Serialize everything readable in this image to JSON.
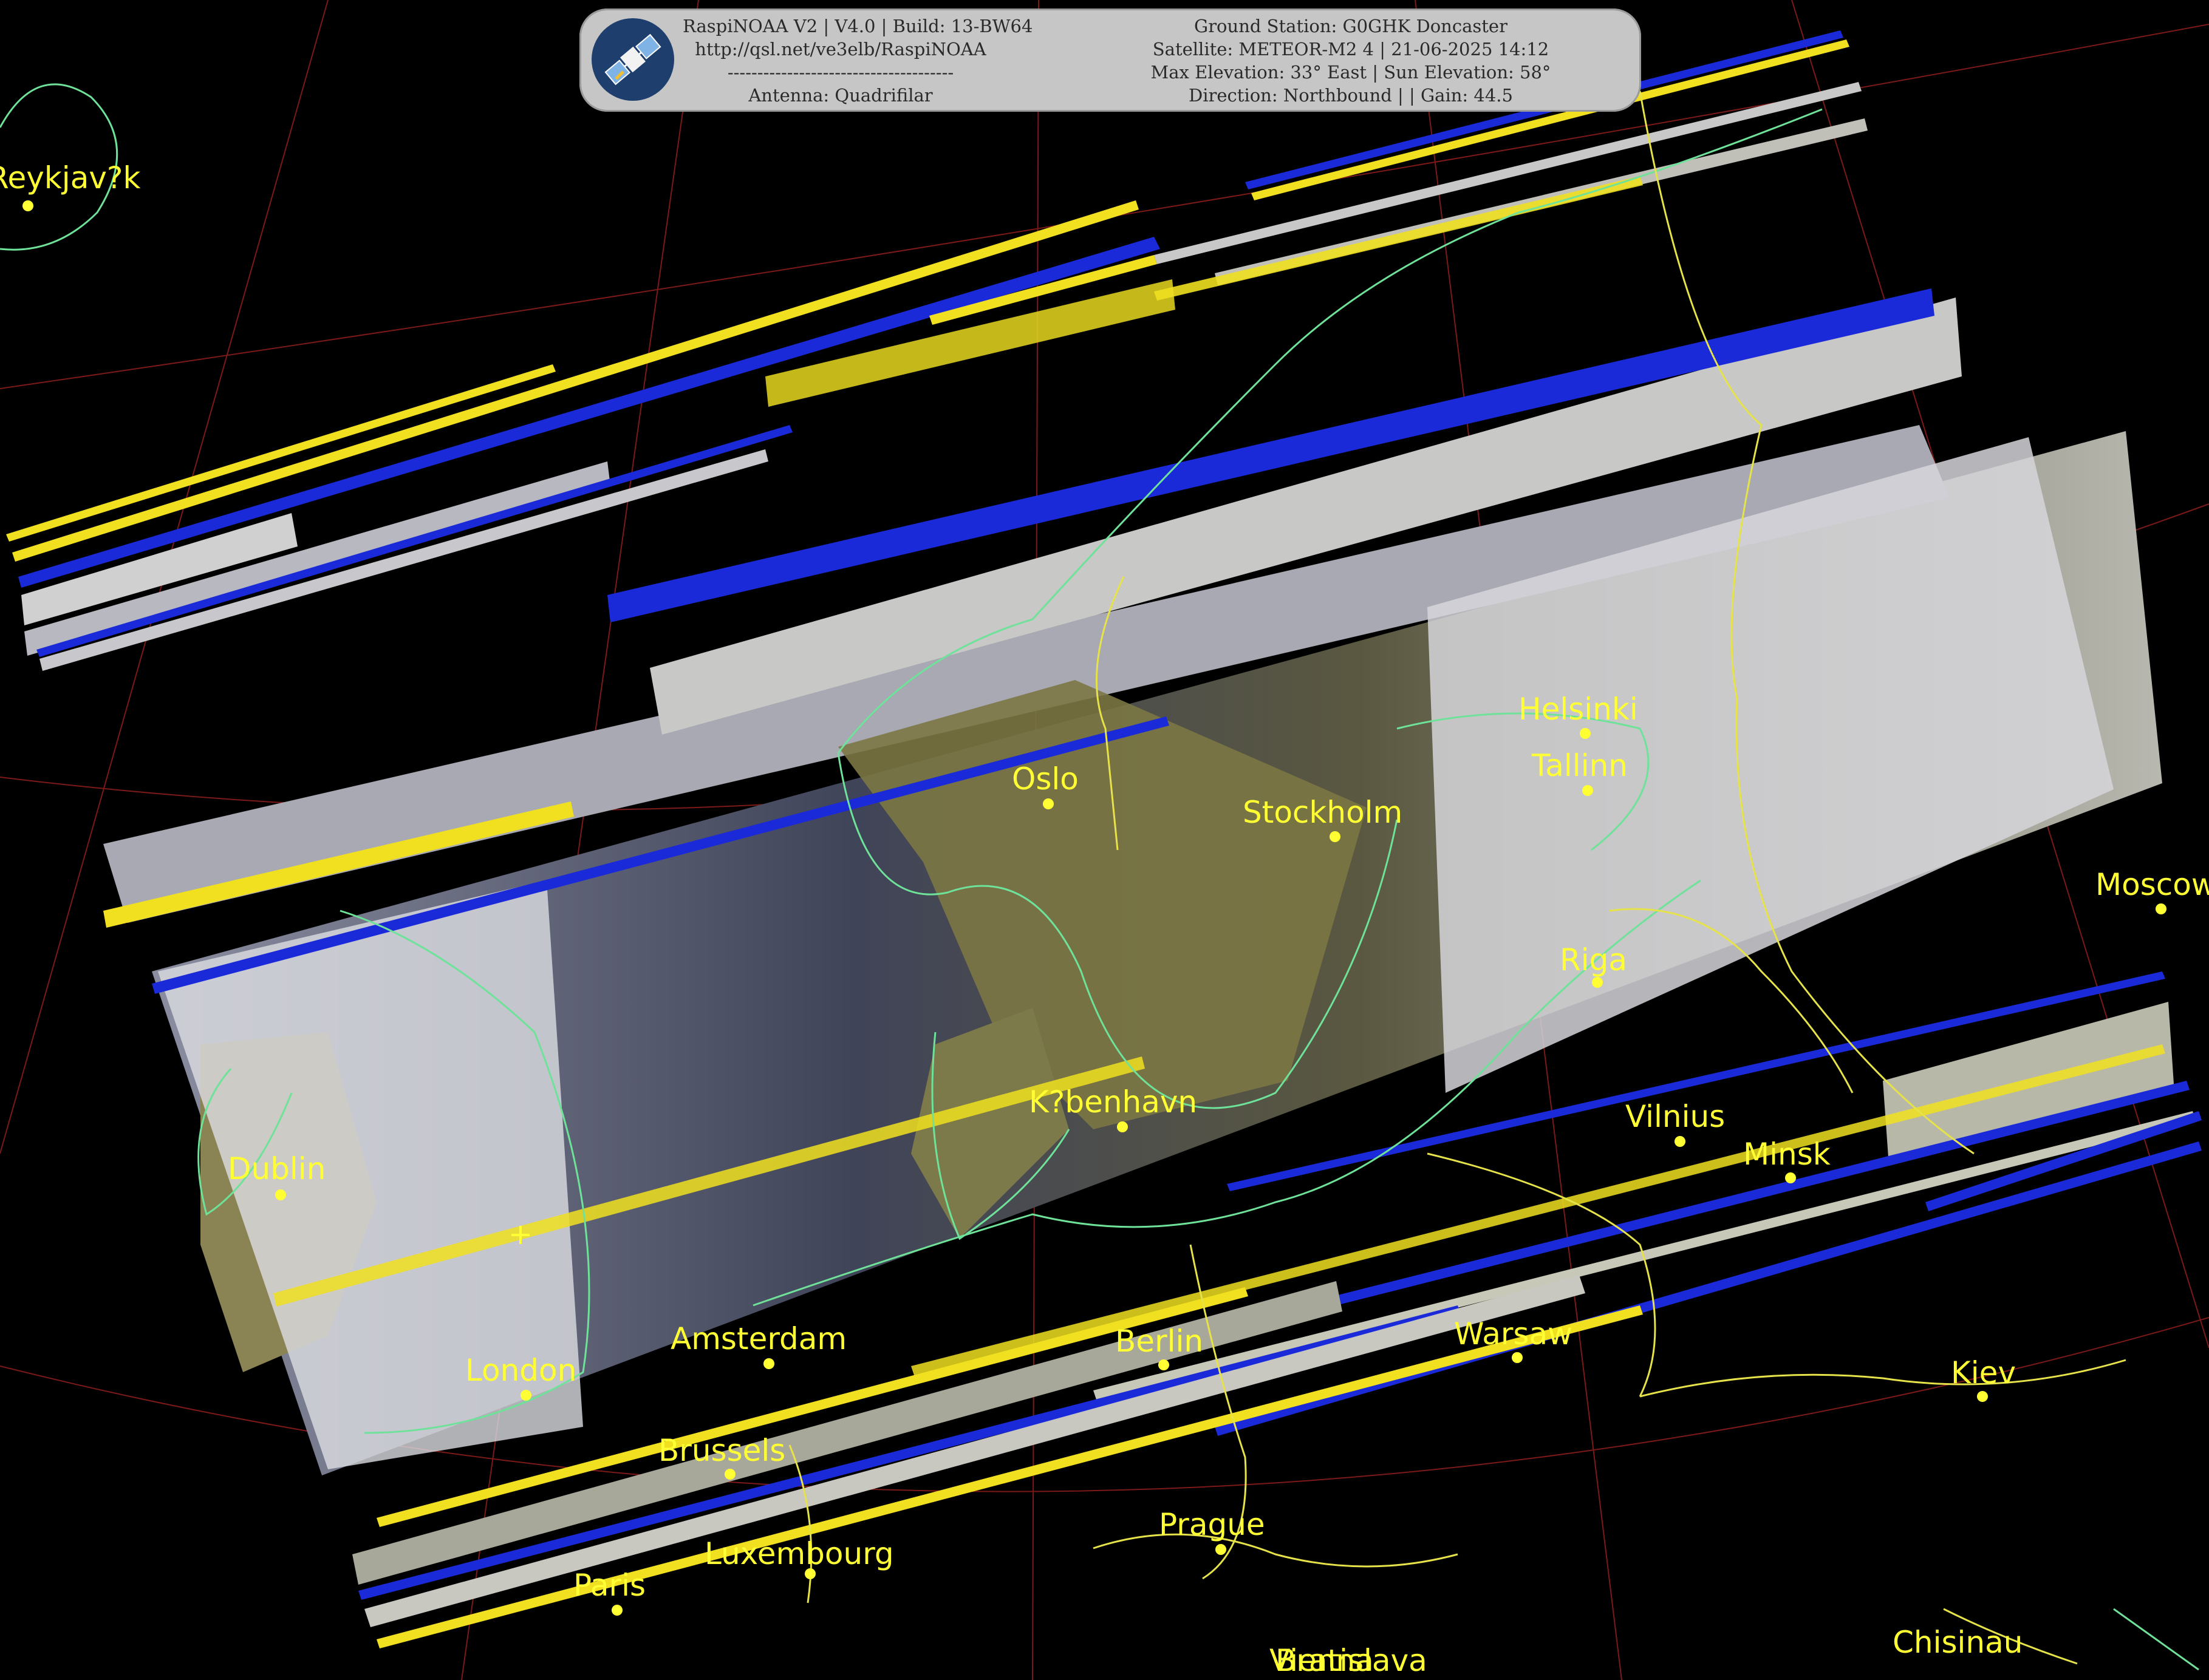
{
  "info": {
    "line1_left": "RaspiNOAA V2 | V4.0 | Build: 13-BW64",
    "line2_left": "http://qsl.net/ve3elb/RaspiNOAA",
    "line3_left": "--------------------------------------",
    "line4_left": "Antenna: Quadrifilar",
    "line1_right": "Ground Station: G0GHK Doncaster",
    "line2_right": "Satellite: METEOR-M2 4 | 21-06-2025 14:12",
    "line3_right": "Max Elevation: 33° East | Sun Elevation: 58°",
    "line4_right": "Direction: Northbound | | Gain: 44.5"
  },
  "cities": [
    {
      "name": "Reykjav?k",
      "key": "reykjavik"
    },
    {
      "name": "Helsinki",
      "key": "helsinki"
    },
    {
      "name": "Tallinn",
      "key": "tallinn"
    },
    {
      "name": "Oslo",
      "key": "oslo"
    },
    {
      "name": "Stockholm",
      "key": "stockholm"
    },
    {
      "name": "Moscow",
      "key": "moscow"
    },
    {
      "name": "Riga",
      "key": "riga"
    },
    {
      "name": "K?benhavn",
      "key": "kobenhavn"
    },
    {
      "name": "Vilnius",
      "key": "vilnius"
    },
    {
      "name": "Minsk",
      "key": "minsk"
    },
    {
      "name": "Dublin",
      "key": "dublin"
    },
    {
      "name": "Amsterdam",
      "key": "amsterdam"
    },
    {
      "name": "Berlin",
      "key": "berlin"
    },
    {
      "name": "Warsaw",
      "key": "warsaw"
    },
    {
      "name": "London",
      "key": "london"
    },
    {
      "name": "Kiev",
      "key": "kiev"
    },
    {
      "name": "Brussels",
      "key": "brussels"
    },
    {
      "name": "Prague",
      "key": "prague"
    },
    {
      "name": "Luxembourg",
      "key": "luxembourg"
    },
    {
      "name": "Paris",
      "key": "paris"
    },
    {
      "name": "Bratislava",
      "key": "bratislava"
    },
    {
      "name": "Vienna",
      "key": "vienna"
    },
    {
      "name": "Chisinau",
      "key": "chisinau"
    }
  ],
  "colors": {
    "background": "#000000",
    "coastline": "#6fe29a",
    "border": "#e6e24a",
    "graticule": "#8a1c1c",
    "label": "#ffff33",
    "land": "#8c8a4e",
    "sea": "#2c2e40",
    "cloud": "#d8dae0",
    "noise_yellow": "#f0e020",
    "noise_blue": "#1a2ad8"
  }
}
